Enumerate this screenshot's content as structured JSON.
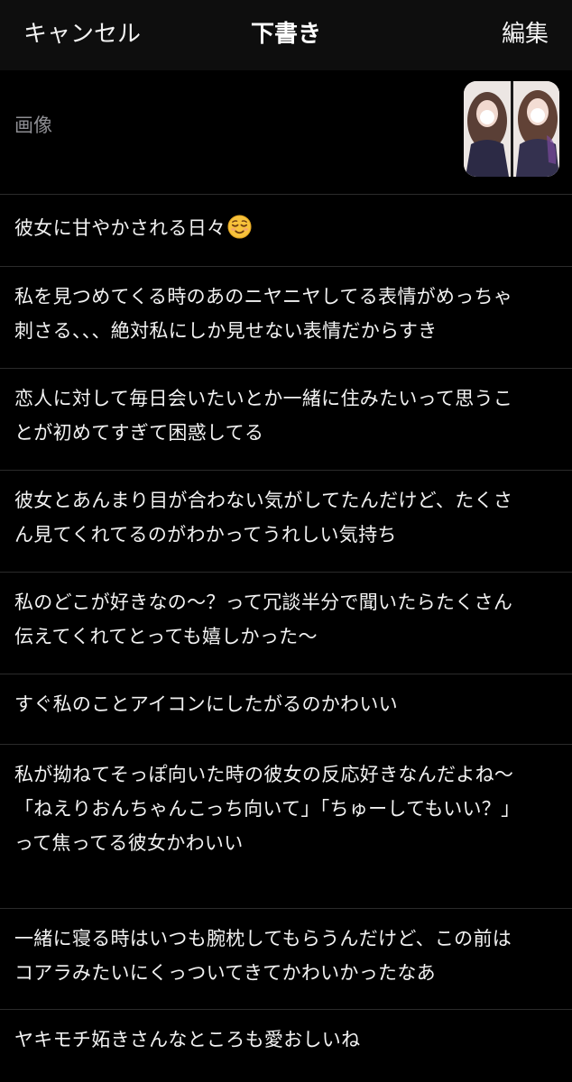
{
  "nav": {
    "cancel_label": "キャンセル",
    "title": "下書き",
    "edit_label": "編集"
  },
  "image_row": {
    "label": "画像",
    "thumbnail_icon": "photo-thumbnail-icon"
  },
  "entries": [
    {
      "text": "彼女に甘やかされる日々",
      "emoji_icon": "relieved-face-emoji"
    },
    {
      "text": "私を見つめてくる時のあのニヤニヤしてる表情がめっちゃ\n刺さる、、、絶対私にしか見せない表情だからすき"
    },
    {
      "text": "恋人に対して毎日会いたいとか一緒に住みたいって思うこ\nとが初めてすぎて困惑してる"
    },
    {
      "text": "彼女とあんまり目が合わない気がしてたんだけど、たくさ\nん見てくれてるのがわかってうれしい気持ち"
    },
    {
      "text": "私のどこが好きなの〜？って冗談半分で聞いたらたくさん\n伝えてくれてとっても嬉しかった〜"
    },
    {
      "text": "すぐ私のことアイコンにしたがるのかわいい"
    },
    {
      "text": "私が拗ねてそっぽ向いた時の彼女の反応好きなんだよね〜\n「ねえりおんちゃんこっち向いて」「ちゅーしてもいい？」\nって焦ってる彼女かわいい"
    },
    {
      "text": "一緒に寝る時はいつも腕枕してもらうんだけど、この前は\nコアラみたいにくっついてきてかわいかったなあ"
    },
    {
      "text": "ヤキモチ妬きさんなところも愛おしいね"
    }
  ],
  "colors": {
    "background": "#000000",
    "navbar": "#0e0e0e",
    "text": "#f2f2f2",
    "secondary_text": "#8e8e93",
    "separator": "#2b2b2b"
  }
}
